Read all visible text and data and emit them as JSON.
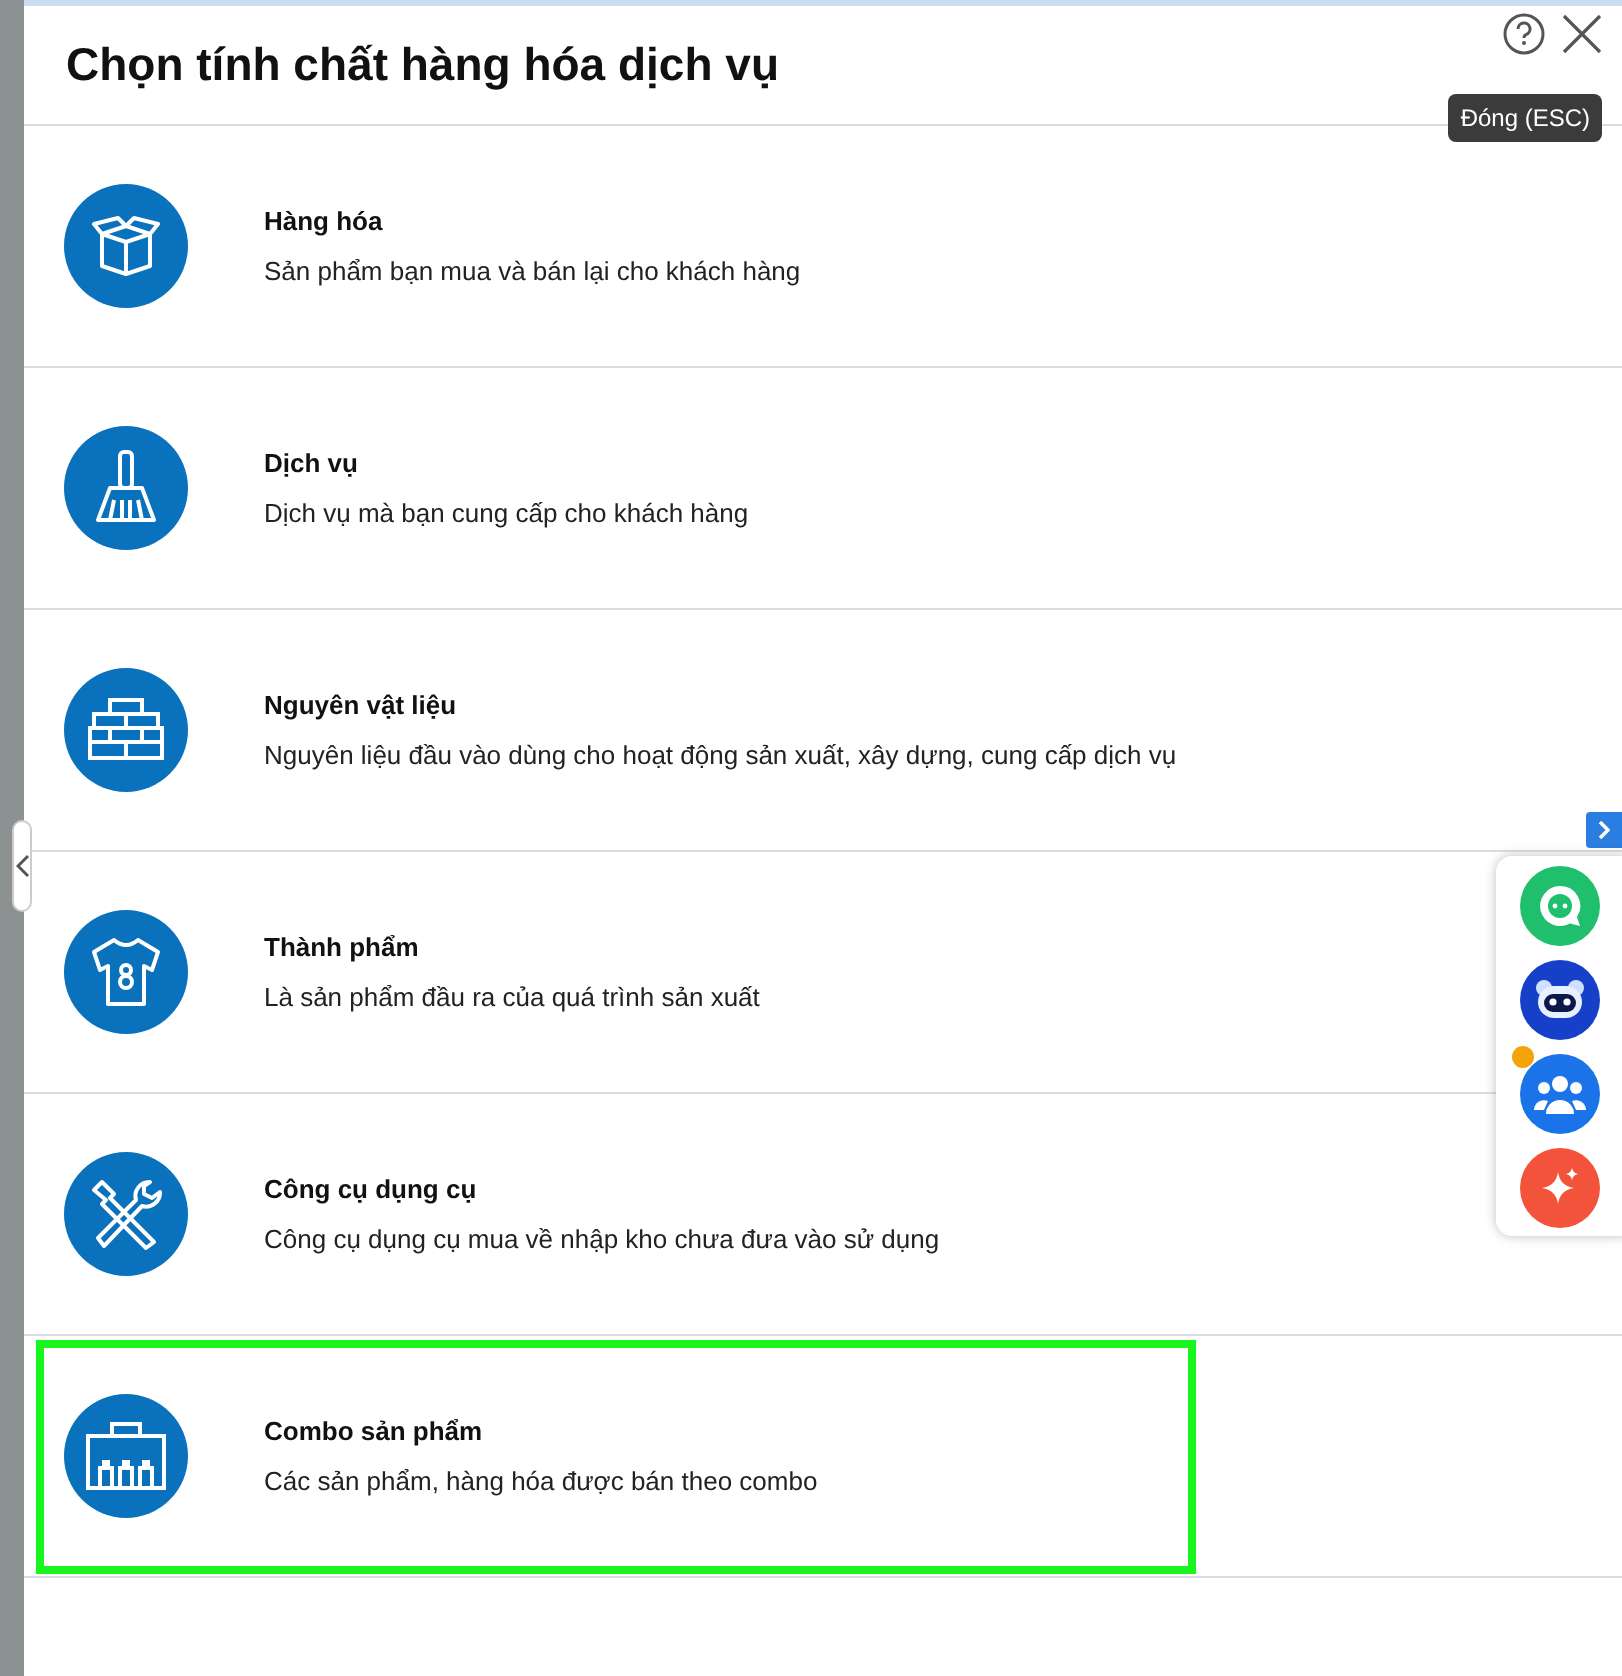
{
  "dialog": {
    "title": "Chọn tính chất hàng hóa dịch vụ",
    "close_tooltip": "Đóng (ESC)",
    "items": [
      {
        "kind": "box",
        "name": "Hàng hóa",
        "description": "Sản phẩm bạn mua và bán lại cho khách hàng",
        "selected": false
      },
      {
        "kind": "broom",
        "name": "Dịch vụ",
        "description": "Dịch vụ mà bạn cung cấp cho khách hàng",
        "selected": false
      },
      {
        "kind": "bricks",
        "name": "Nguyên vật liệu",
        "description": "Nguyên liệu đầu vào dùng cho hoạt động sản xuất, xây dựng, cung cấp dịch vụ",
        "selected": false
      },
      {
        "kind": "shirt",
        "name": "Thành phẩm",
        "description": "Là sản phẩm đầu ra của quá trình sản xuất",
        "selected": false
      },
      {
        "kind": "tools",
        "name": "Công cụ dụng cụ",
        "description": "Công cụ dụng cụ mua về nhập kho chưa đưa vào sử dụng",
        "selected": false
      },
      {
        "kind": "combo",
        "name": "Combo sản phẩm",
        "description": "Các sản phẩm, hàng hóa được bán theo combo",
        "selected": true
      }
    ]
  },
  "floating_tools": [
    {
      "kind": "chat",
      "color": "#1fbf6e"
    },
    {
      "kind": "robot",
      "color": "#1740c8"
    },
    {
      "kind": "people",
      "color": "#1a73e8"
    },
    {
      "kind": "sparkle",
      "color": "#f2533a"
    }
  ]
}
